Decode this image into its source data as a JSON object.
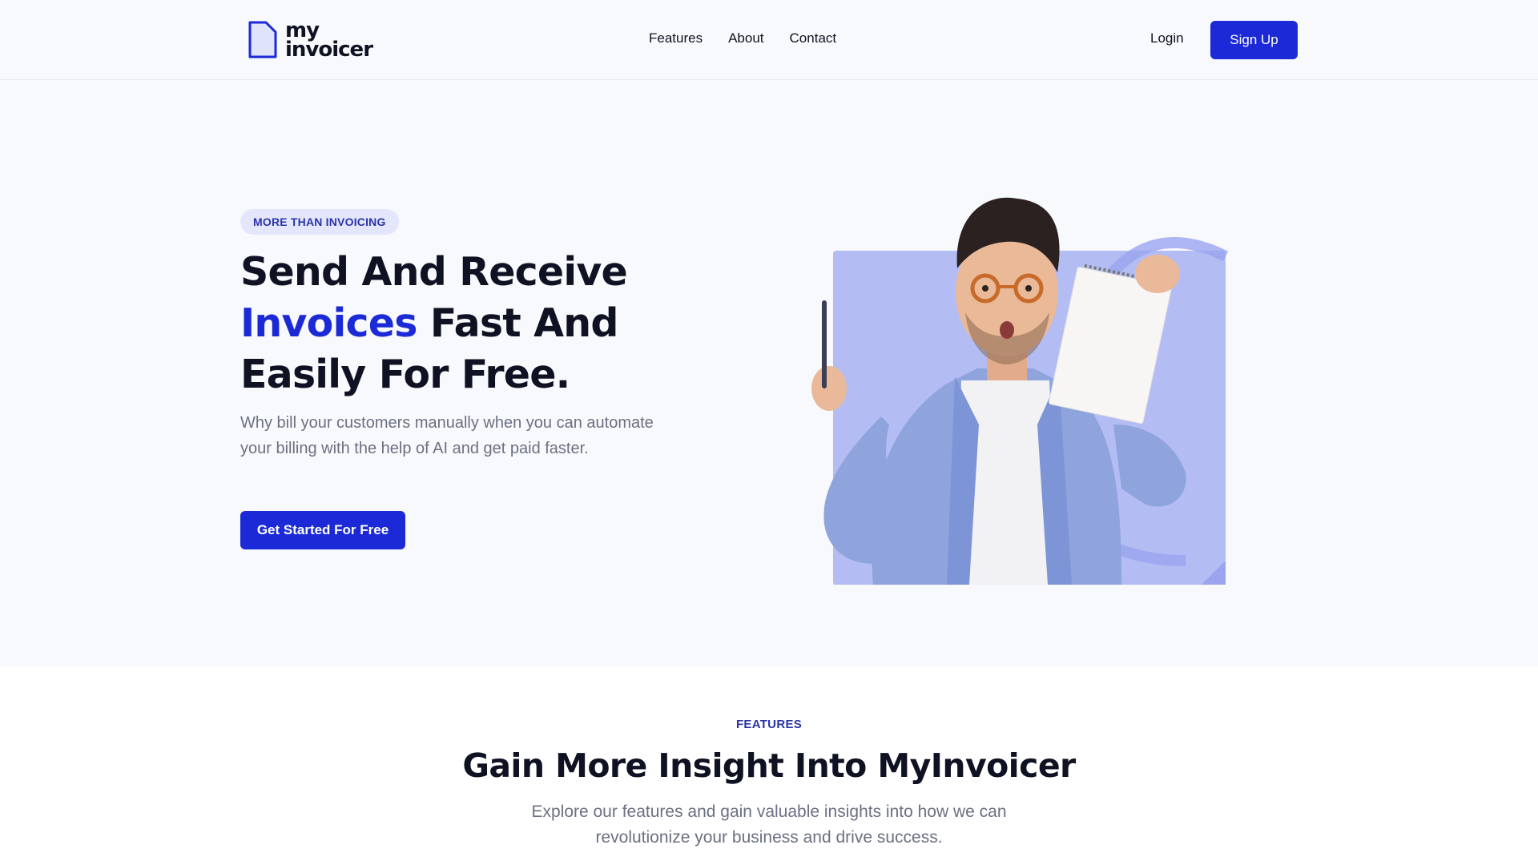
{
  "brand": {
    "logo_line1": "my",
    "logo_line2": "invoicer",
    "accent_color": "#1b2ad6"
  },
  "nav": {
    "items": [
      {
        "label": "Features"
      },
      {
        "label": "About"
      },
      {
        "label": "Contact"
      }
    ],
    "login_label": "Login",
    "signup_label": "Sign Up"
  },
  "hero": {
    "badge": "MORE THAN INVOICING",
    "title_part1": "Send And Receive ",
    "title_accent": "Invoices",
    "title_part2": " Fast And Easily For Free.",
    "description": "Why bill your customers manually when you can automate your billing with the help of AI and get paid faster.",
    "cta_label": "Get Started For Free",
    "image_icon": "person-holding-notepad-illustration"
  },
  "features": {
    "eyebrow": "FEATURES",
    "title": "Gain More Insight Into MyInvoicer",
    "description": "Explore our features and gain valuable insights into how we can revolutionize your business and drive success."
  }
}
